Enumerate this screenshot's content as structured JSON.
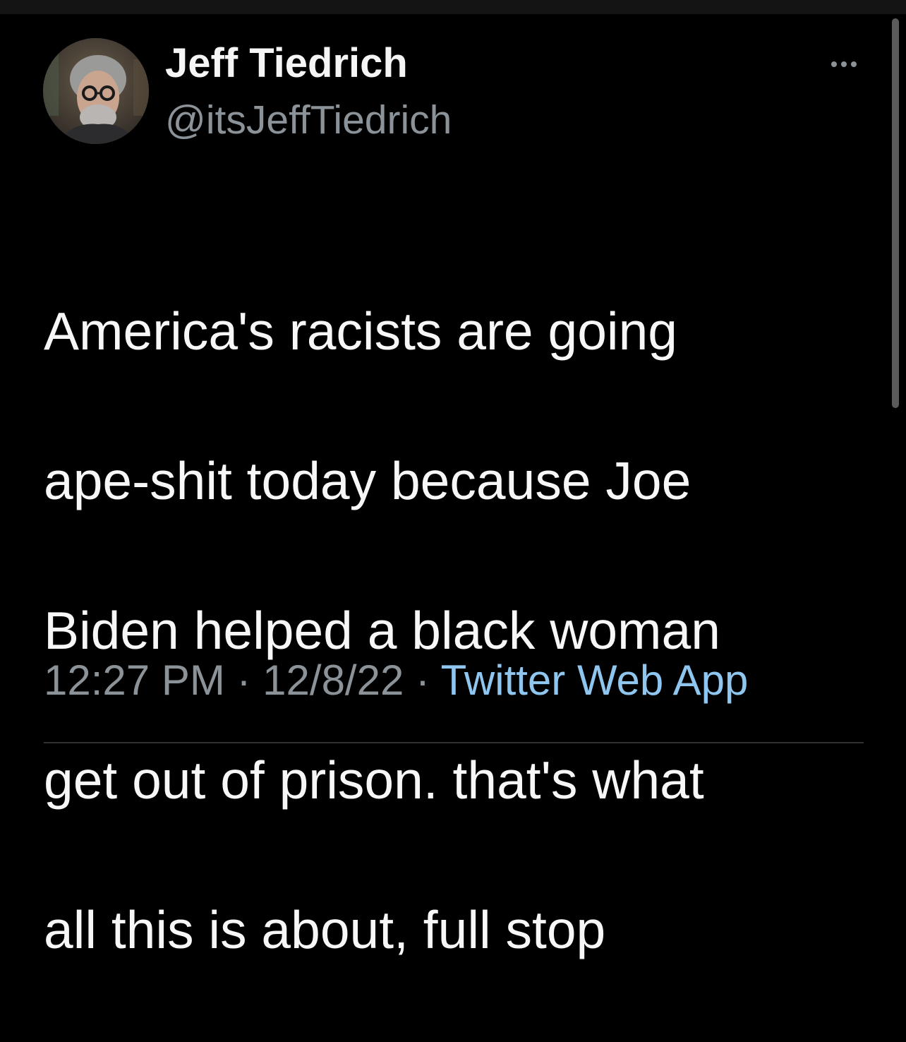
{
  "tweet": {
    "author": {
      "name": "Jeff Tiedrich",
      "handle": "@itsJeffTiedrich"
    },
    "text_lines": [
      "America's racists are going",
      "ape-shit today because Joe",
      "Biden helped a black woman",
      "get out of prison. that's what",
      "all this is about, full stop"
    ],
    "time": "12:27 PM",
    "separator": "·",
    "date": "12/8/22",
    "source": "Twitter Web App"
  },
  "colors": {
    "background": "#000000",
    "primary_text": "#f7f7f7",
    "secondary_text": "#8b9298",
    "link": "#8fc6ef",
    "divider": "#2f3336"
  },
  "icons": {
    "more": "more-horizontal-icon"
  }
}
